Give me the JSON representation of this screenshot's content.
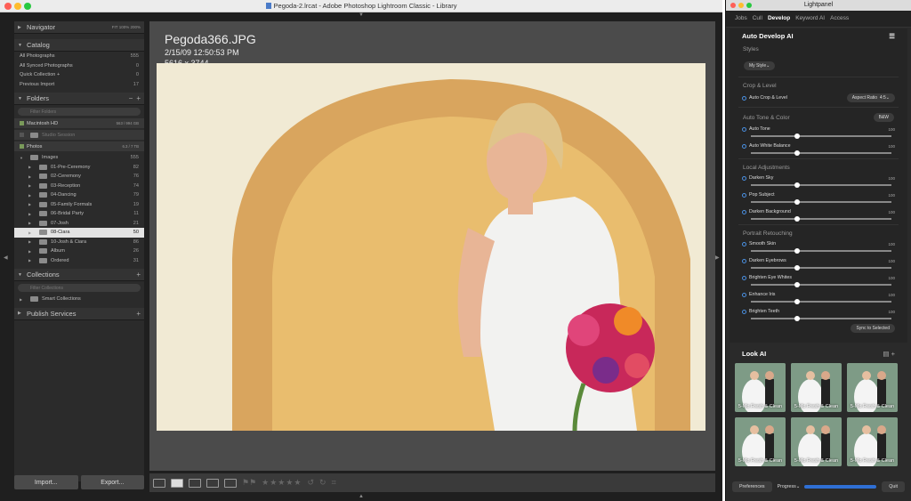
{
  "window": {
    "title": "Pegoda-2.lrcat - Adobe Photoshop Lightroom Classic - Library"
  },
  "navigator": {
    "title": "Navigator",
    "zoom": [
      "FIT",
      "100%",
      "200%"
    ]
  },
  "catalog": {
    "title": "Catalog",
    "items": [
      {
        "label": "All Photographs",
        "count": "555"
      },
      {
        "label": "All Synced Photographs",
        "count": "0"
      },
      {
        "label": "Quick Collection +",
        "count": "0"
      },
      {
        "label": "Previous Import",
        "count": "17"
      }
    ]
  },
  "folders": {
    "title": "Folders",
    "filter_placeholder": "Filter Folders",
    "volumes": [
      {
        "label": "Macintosh HD",
        "info": "563 / 994 GB"
      },
      {
        "label": "Studio Session",
        "info": ""
      },
      {
        "label": "Photos",
        "info": "6.3 / 7 TB"
      }
    ],
    "root": {
      "label": "Images",
      "count": "555"
    },
    "items": [
      {
        "label": "01-Pre-Ceremony",
        "count": "82"
      },
      {
        "label": "02-Ceremony",
        "count": "76"
      },
      {
        "label": "03-Reception",
        "count": "74"
      },
      {
        "label": "04-Dancing",
        "count": "79"
      },
      {
        "label": "05-Family Formals",
        "count": "19"
      },
      {
        "label": "06-Bridal Party",
        "count": "11"
      },
      {
        "label": "07-Josh",
        "count": "21"
      },
      {
        "label": "08-Ciara",
        "count": "50"
      },
      {
        "label": "10-Josh & Ciara",
        "count": "86"
      },
      {
        "label": "Album",
        "count": "26"
      },
      {
        "label": "Ordered",
        "count": "31"
      }
    ],
    "selected": "08-Ciara"
  },
  "collections": {
    "title": "Collections",
    "filter_placeholder": "Filter Collections",
    "items": [
      {
        "label": "Smart Collections"
      }
    ]
  },
  "publish": {
    "title": "Publish Services"
  },
  "buttons": {
    "import": "Import...",
    "export": "Export..."
  },
  "photo": {
    "filename": "Pegoda366.JPG",
    "datetime": "2/15/09 12:50:53 PM",
    "dimensions": "5616 x 3744"
  },
  "lightpanel": {
    "title": "Lightpanel",
    "tabs": [
      "Jobs",
      "Cull",
      "Develop",
      "Keyword AI",
      "Access"
    ],
    "active_tab": "Develop",
    "header": "Auto Develop AI",
    "styles_label": "Styles",
    "style_value": "My Style",
    "crop_section": "Crop & Level",
    "auto_crop": "Auto Crop & Level",
    "aspect_label": "Aspect Ratio",
    "aspect_value": "4:5",
    "tone_section": "Auto Tone & Color",
    "bw": "B&W",
    "tone_options": [
      {
        "label": "Auto Tone",
        "value": "100",
        "level": 0.33
      },
      {
        "label": "Auto White Balance",
        "value": "100",
        "level": 0.33
      }
    ],
    "local_section": "Local Adjustments",
    "local_options": [
      {
        "label": "Darken Sky",
        "value": "100",
        "level": 0.33
      },
      {
        "label": "Pop Subject",
        "value": "100",
        "level": 0.33
      },
      {
        "label": "Darken Background",
        "value": "100",
        "level": 0.33
      }
    ],
    "portrait_section": "Portrait Retouching",
    "portrait_options": [
      {
        "label": "Smooth Skin",
        "value": "100",
        "level": 0.33
      },
      {
        "label": "Darken Eyebrows",
        "value": "100",
        "level": 0.33
      },
      {
        "label": "Brighten Eye Whites",
        "value": "100",
        "level": 0.33
      },
      {
        "label": "Enhance Iris",
        "value": "100",
        "level": 0.33
      },
      {
        "label": "Brighten Teeth",
        "value": "100",
        "level": 0.33
      }
    ],
    "sync": "Sync to Selected",
    "look_title": "Look AI",
    "looks": [
      "5-Mo Fresh & Clean",
      "5-Mo Fresh & Clean",
      "5-Mo Fresh & Clean",
      "5-Mo Fresh & Clean",
      "5-Mo Fresh & Clean",
      "5-Mo Fresh & Clean"
    ],
    "preferences": "Preferences",
    "progress": "Progress",
    "quit": "Quit"
  },
  "colors": {
    "accent": "#2f6fd4",
    "wall": "#e2b46a"
  }
}
